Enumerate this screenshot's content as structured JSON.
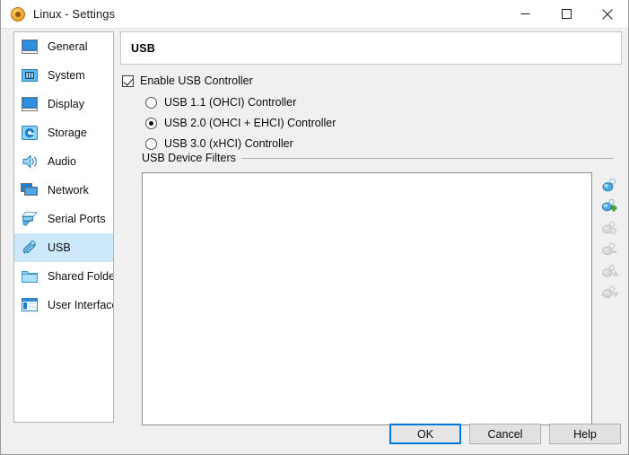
{
  "window": {
    "title": "Linux - Settings",
    "icon": "vbox-settings-icon",
    "controls": {
      "minimize": "minimize-icon",
      "maximize": "maximize-icon",
      "close": "close-icon"
    }
  },
  "sidebar": {
    "items": [
      {
        "label": "General",
        "icon": "monitor-icon",
        "selected": false
      },
      {
        "label": "System",
        "icon": "motherboard-icon",
        "selected": false
      },
      {
        "label": "Display",
        "icon": "display-icon",
        "selected": false
      },
      {
        "label": "Storage",
        "icon": "harddisk-icon",
        "selected": false
      },
      {
        "label": "Audio",
        "icon": "speaker-icon",
        "selected": false
      },
      {
        "label": "Network",
        "icon": "network-icon",
        "selected": false
      },
      {
        "label": "Serial Ports",
        "icon": "serial-port-icon",
        "selected": false
      },
      {
        "label": "USB",
        "icon": "usb-icon",
        "selected": true
      },
      {
        "label": "Shared Folders",
        "icon": "folder-icon",
        "selected": false
      },
      {
        "label": "User Interface",
        "icon": "window-icon",
        "selected": false
      }
    ]
  },
  "page": {
    "header_title": "USB",
    "enable_checkbox": {
      "label": "Enable USB Controller",
      "checked": true
    },
    "controller_options": [
      {
        "label": "USB 1.1 (OHCI) Controller",
        "selected": false
      },
      {
        "label": "USB 2.0 (OHCI + EHCI) Controller",
        "selected": true
      },
      {
        "label": "USB 3.0 (xHCI) Controller",
        "selected": false
      }
    ],
    "filters": {
      "legend": "USB Device Filters",
      "items": [],
      "toolbar": [
        {
          "name": "add-empty-filter-button",
          "icon": "usb-plug-icon",
          "enabled": true
        },
        {
          "name": "add-filter-from-device-button",
          "icon": "usb-plug-plus-icon",
          "enabled": true
        },
        {
          "name": "edit-filter-button",
          "icon": "usb-plug-edit-icon",
          "enabled": false
        },
        {
          "name": "remove-filter-button",
          "icon": "usb-plug-remove-icon",
          "enabled": false
        },
        {
          "name": "move-filter-up-button",
          "icon": "usb-plug-up-icon",
          "enabled": false
        },
        {
          "name": "move-filter-down-button",
          "icon": "usb-plug-down-icon",
          "enabled": false
        }
      ]
    }
  },
  "footer": {
    "buttons": [
      {
        "label": "OK",
        "name": "ok-button",
        "default": true
      },
      {
        "label": "Cancel",
        "name": "cancel-button",
        "default": false
      },
      {
        "label": "Help",
        "name": "help-button",
        "default": false
      }
    ]
  },
  "colors": {
    "selection": "#cce8fa",
    "accent": "#0078d7",
    "dialog_bg": "#f0f0f0",
    "panel_bg": "#ffffff"
  }
}
